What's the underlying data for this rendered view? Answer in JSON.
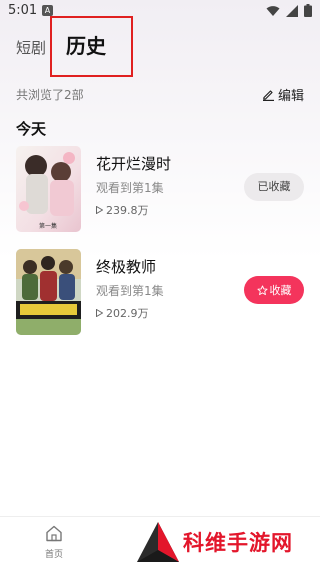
{
  "status": {
    "time": "5:01",
    "app_icon_letter": "A"
  },
  "header": {
    "tab_shortdrama": "短剧",
    "tab_history": "历史"
  },
  "summary": {
    "text": "共浏览了2部",
    "edit_label": "编辑"
  },
  "section": {
    "today": "今天"
  },
  "items": [
    {
      "title": "花开烂漫时",
      "progress": "观看到第1集",
      "views": "239.8万",
      "button": "已收藏",
      "poster_caption": "第一集"
    },
    {
      "title": "终极教师",
      "progress": "观看到第1集",
      "views": "202.9万",
      "button": "收藏"
    }
  ],
  "tabbar": {
    "home_label": "首页"
  },
  "watermark": {
    "text": "科维手游网"
  },
  "colors": {
    "accent": "#f4345c",
    "highlight": "#e02020",
    "watermark": "#e3162b"
  }
}
